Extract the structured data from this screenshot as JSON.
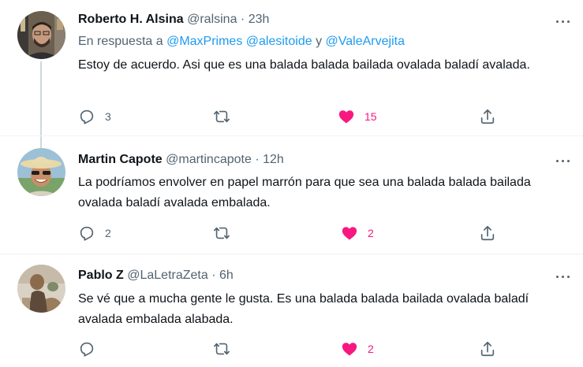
{
  "tweets": [
    {
      "name": "Roberto H. Alsina",
      "handle": "@ralsina",
      "time": "23h",
      "reply_prefix": "En respuesta a",
      "reply_mentions": [
        "@MaxPrimes",
        "@alesitoide"
      ],
      "reply_joiner": "y",
      "reply_last": "@ValeArvejita",
      "text": "Estoy de acuerdo. Asi que es una balada balada bailada ovalada baladí avalada.",
      "reply_count": "3",
      "retweet_count": "",
      "like_count": "15",
      "liked": true
    },
    {
      "name": "Martin Capote",
      "handle": "@martincapote",
      "time": "12h",
      "text": "La podríamos envolver en papel marrón para que sea una balada balada bailada ovalada baladí avalada embalada.",
      "reply_count": "2",
      "retweet_count": "",
      "like_count": "2",
      "liked": true
    },
    {
      "name": "Pablo Z",
      "handle": "@LaLetraZeta",
      "time": "6h",
      "text": "Se vé que a mucha gente le gusta. Es una balada balada bailada ovalada baladí avalada embalada alabada.",
      "reply_count": "",
      "retweet_count": "",
      "like_count": "2",
      "liked": true
    }
  ],
  "separator_dot": "·",
  "colors": {
    "accent": "#1d9bf0",
    "like": "#f91880",
    "muted": "#536471",
    "text": "#0f1419",
    "thread_line": "#cfd9de"
  },
  "icons": [
    "reply-icon",
    "retweet-icon",
    "like-icon",
    "share-icon",
    "more-icon"
  ]
}
